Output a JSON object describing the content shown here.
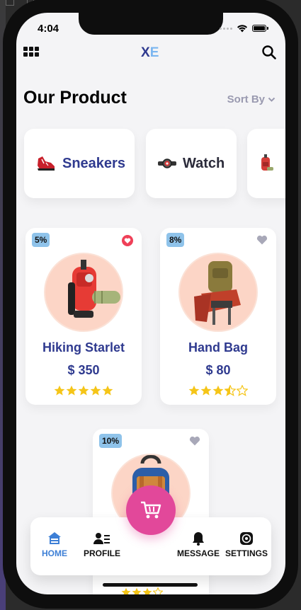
{
  "status_bar": {
    "time": "4:04"
  },
  "app": {
    "logo": {
      "first": "X",
      "second": "E"
    }
  },
  "header": {
    "title": "Our Product",
    "sort_label": "Sort By"
  },
  "categories": [
    {
      "label": "Sneakers",
      "icon": "sneaker-icon",
      "color": "#2f3a8f"
    },
    {
      "label": "Watch",
      "icon": "watch-icon",
      "color": "#2b2b3a"
    },
    {
      "label": "",
      "icon": "backpack-icon",
      "color": "#2b2b3a"
    }
  ],
  "products": [
    {
      "discount": "5%",
      "name": "Hiking Starlet",
      "price": "$ 350",
      "rating": 5,
      "max_rating": 5,
      "favorite": true
    },
    {
      "discount": "8%",
      "name": "Hand Bag",
      "price": "$ 80",
      "rating": 3.5,
      "max_rating": 5,
      "favorite": false
    },
    {
      "discount": "10%",
      "name": "",
      "price": "",
      "rating": 3,
      "max_rating": 5,
      "favorite": false
    }
  ],
  "bottom_nav": {
    "items": [
      {
        "label": "HOME",
        "icon": "home-icon",
        "active": true
      },
      {
        "label": "PROFILE",
        "icon": "profile-icon",
        "active": false
      },
      {
        "label": "MESSAGE",
        "icon": "bell-icon",
        "active": false
      },
      {
        "label": "SETTINGS",
        "icon": "settings-icon",
        "active": false
      }
    ],
    "fab_icon": "cart-icon"
  },
  "colors": {
    "accent": "#2f3a8f",
    "fab": "#e2489a",
    "active_nav": "#3d7fd6",
    "discount_badge": "#8fc3ea",
    "favorite_heart": "#ef4058",
    "star": "#f5c518"
  }
}
